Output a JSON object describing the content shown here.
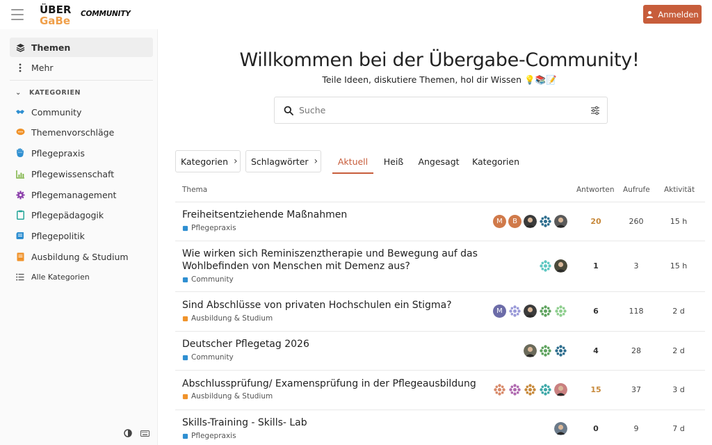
{
  "header": {
    "logo_alt": "ÜBER GABE",
    "logo_line1": "ÜBER",
    "logo_line2": "GaBe",
    "brand": "COMMUNITY",
    "login_label": "Anmelden"
  },
  "sidebar": {
    "primary": [
      {
        "label": "Themen",
        "icon": "layers-icon"
      },
      {
        "label": "Mehr",
        "icon": "vertical-dots-icon"
      }
    ],
    "categories_heading": "KATEGORIEN",
    "categories": [
      {
        "label": "Community",
        "icon": "handshake-icon",
        "color": "#2f8fd1"
      },
      {
        "label": "Themenvorschläge",
        "icon": "speech-bubble-icon",
        "color": "#f0932b"
      },
      {
        "label": "Pflegepraxis",
        "icon": "hand-icon",
        "color": "#2f8fd1"
      },
      {
        "label": "Pflegewissenschaft",
        "icon": "chart-icon",
        "color": "#7cb342"
      },
      {
        "label": "Pflegemanagement",
        "icon": "gear-icon",
        "color": "#8e44ad"
      },
      {
        "label": "Pflegepädagogik",
        "icon": "clipboard-icon",
        "color": "#26a69a"
      },
      {
        "label": "Pflegepolitik",
        "icon": "scroll-icon",
        "color": "#2f8fd1"
      },
      {
        "label": "Ausbildung & Studium",
        "icon": "book-icon",
        "color": "#f0932b"
      },
      {
        "label": "Alle Kategorien",
        "icon": "list-icon",
        "color": "#555555"
      }
    ]
  },
  "hero": {
    "title": "Willkommen bei der Übergabe-Community!",
    "subtitle": "Teile Ideen, diskutiere Themen, hol dir Wissen 💡📚📝"
  },
  "search": {
    "placeholder": "Suche"
  },
  "filters": {
    "categories_label": "Kategorien",
    "tags_label": "Schlagwörter"
  },
  "tabs": [
    {
      "label": "Aktuell",
      "active": true
    },
    {
      "label": "Heiß",
      "active": false
    },
    {
      "label": "Angesagt",
      "active": false
    },
    {
      "label": "Kategorien",
      "active": false
    }
  ],
  "table": {
    "col_topic": "Thema",
    "col_replies": "Antworten",
    "col_views": "Aufrufe",
    "col_activity": "Aktivität",
    "rows": [
      {
        "title": "Freiheitsentziehende Maßnahmen",
        "category": "Pflegepraxis",
        "category_color": "#2f8fd1",
        "replies": "20",
        "hot": true,
        "views": "260",
        "activity": "15 h",
        "avatars": [
          {
            "letter": "M",
            "color": "#d07a4a",
            "kind": "letter"
          },
          {
            "letter": "B",
            "color": "#d07a4a",
            "kind": "letter"
          },
          {
            "letter": "",
            "color": "#3b3b3b",
            "kind": "photo"
          },
          {
            "letter": "",
            "color": "#2e6e8e",
            "kind": "pattern"
          },
          {
            "letter": "",
            "color": "#5a5a5a",
            "kind": "photo"
          }
        ]
      },
      {
        "title": "Wie wirken sich Reminiszenztherapie und Bewegung auf das Wohlbefinden von Menschen mit Demenz aus?",
        "category": "Community",
        "category_color": "#2f8fd1",
        "replies": "1",
        "hot": false,
        "views": "3",
        "activity": "15 h",
        "avatars": [
          {
            "letter": "",
            "color": "#5ec7c2",
            "kind": "pattern"
          },
          {
            "letter": "",
            "color": "#4a4a3a",
            "kind": "photo"
          }
        ]
      },
      {
        "title": "Sind Abschlüsse von privaten Hochschulen ein Stigma?",
        "category": "Ausbildung & Studium",
        "category_color": "#f0932b",
        "replies": "6",
        "hot": false,
        "views": "118",
        "activity": "2 d",
        "avatars": [
          {
            "letter": "M",
            "color": "#6c6ca8",
            "kind": "letter"
          },
          {
            "letter": "",
            "color": "#9a9ad8",
            "kind": "pattern"
          },
          {
            "letter": "",
            "color": "#3b3b3b",
            "kind": "photo"
          },
          {
            "letter": "",
            "color": "#5fa35f",
            "kind": "pattern"
          },
          {
            "letter": "",
            "color": "#8fcf8f",
            "kind": "pattern"
          }
        ]
      },
      {
        "title": "Deutscher Pflegetag 2026",
        "category": "Community",
        "category_color": "#2f8fd1",
        "replies": "4",
        "hot": false,
        "views": "28",
        "activity": "2 d",
        "avatars": [
          {
            "letter": "",
            "color": "#6a6a5a",
            "kind": "photo"
          },
          {
            "letter": "",
            "color": "#5fa35f",
            "kind": "pattern"
          },
          {
            "letter": "",
            "color": "#2e6e8e",
            "kind": "pattern"
          }
        ]
      },
      {
        "title": "Abschlussprüfung/ Examensprüfung in der Pflegeausbildung",
        "category": "Ausbildung & Studium",
        "category_color": "#f0932b",
        "replies": "15",
        "hot": true,
        "views": "37",
        "activity": "3 d",
        "avatars": [
          {
            "letter": "",
            "color": "#d88a6a",
            "kind": "pattern"
          },
          {
            "letter": "",
            "color": "#b06ab0",
            "kind": "pattern"
          },
          {
            "letter": "",
            "color": "#c7893b",
            "kind": "pattern"
          },
          {
            "letter": "",
            "color": "#3ea8a8",
            "kind": "pattern"
          },
          {
            "letter": "",
            "color": "#c98080",
            "kind": "photo"
          }
        ]
      },
      {
        "title": "Skills-Training - Skills- Lab",
        "category": "Pflegepraxis",
        "category_color": "#2f8fd1",
        "replies": "0",
        "hot": false,
        "views": "9",
        "activity": "7 d",
        "avatars": [
          {
            "letter": "",
            "color": "#6a7a8a",
            "kind": "photo"
          }
        ]
      }
    ]
  },
  "colors": {
    "accent": "#c75d3b",
    "hot": "#c7893b"
  }
}
